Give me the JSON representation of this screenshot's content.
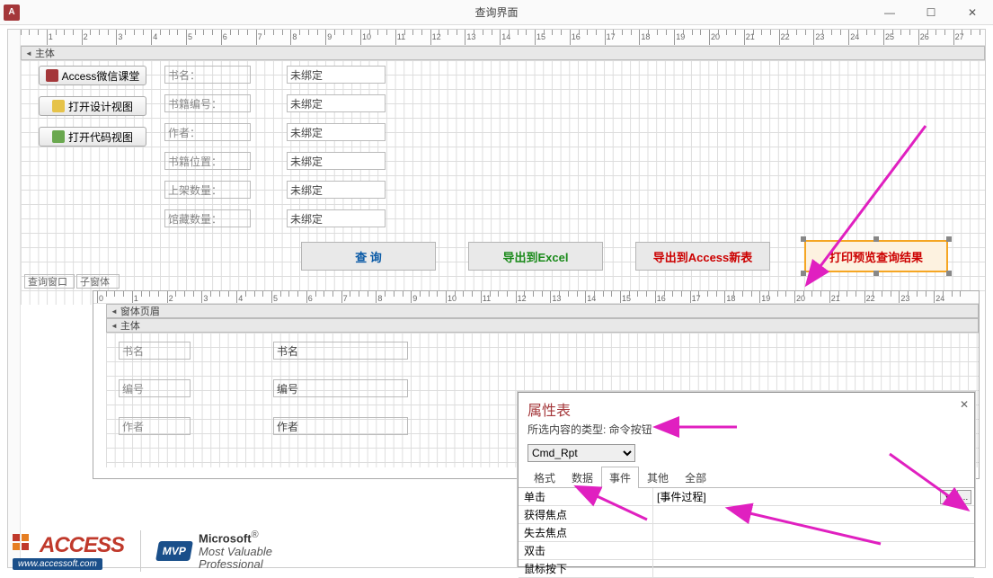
{
  "window": {
    "title": "查询界面"
  },
  "sections": {
    "main": "主体",
    "form_header": "窗体页眉"
  },
  "side_buttons": {
    "wechat": "Access微信课堂",
    "design": "打开设计视图",
    "code": "打开代码视图"
  },
  "fields": {
    "labels": {
      "book_name": "书名：",
      "book_no": "书籍编号：",
      "author": "作者：",
      "location": "书籍位置：",
      "onshelf": "上架数量：",
      "collection": "馆藏数量："
    },
    "unbound": "未绑定"
  },
  "action_buttons": {
    "query": "查  询",
    "export_excel": "导出到Excel",
    "export_access": "导出到Access新表",
    "print_preview": "打印预览查询结果"
  },
  "subform_labels": {
    "query_window": "查询窗口",
    "child_form": "子窗体"
  },
  "subform_fields": {
    "book_name_l": "书名",
    "book_name_c": "书名",
    "book_no_l": "编号",
    "book_no_c": "编号",
    "author_l": "作者",
    "author_c": "作者"
  },
  "property_sheet": {
    "title": "属性表",
    "subtitle_prefix": "所选内容的类型: ",
    "subtitle_type": "命令按钮",
    "object": "Cmd_Rpt",
    "tabs": {
      "format": "格式",
      "data": "数据",
      "event": "事件",
      "other": "其他",
      "all": "全部"
    },
    "events": {
      "click": "单击",
      "gotfocus": "获得焦点",
      "lostfocus": "失去焦点",
      "dblclick": "双击",
      "mousedown": "鼠标按下"
    },
    "click_value": "[事件过程]"
  },
  "logos": {
    "access": "ACCESS",
    "access_url": "www.accessoft.com",
    "mvp_badge": "MVP",
    "ms": "Microsoft",
    "mv": "Most Valuable",
    "pro": "Professional"
  },
  "ruler_max_outer": 27,
  "ruler_max_inner": 24
}
